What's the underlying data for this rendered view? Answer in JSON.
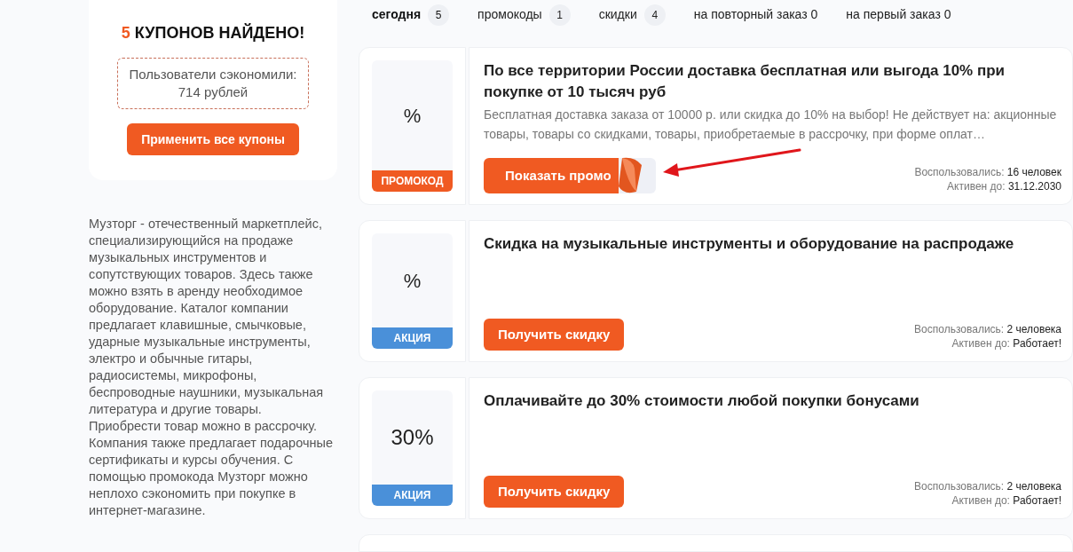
{
  "summary": {
    "count": "5",
    "title": "КУПОНОВ НАЙДЕНО!",
    "savings": "Пользователи сэкономили: 714 рублей",
    "apply_button": "Применить все купоны"
  },
  "description": "Музторг - отечественный маркетплейс, специализирующийся на продаже музыкальных инструментов и сопутствующих товаров. Здесь также можно взять в аренду необходимое оборудование. Каталог компании предлагает клавишные, смычковые, ударные музыкальные инструменты, электро и обычные гитары, радиосистемы, микрофоны, беспроводные наушники, музыкальная литература и другие товары. Приобрести товар можно в рассрочку. Компания также предлагает подарочные сертификаты и курсы обучения. С помощью промокода Музторг можно неплохо сэкономить при покупке в интернет-магазине.",
  "tabs": [
    {
      "label": "сегодня",
      "count": "5",
      "selected": true
    },
    {
      "label": "промокоды",
      "count": "1",
      "selected": false
    },
    {
      "label": "скидки",
      "count": "4",
      "selected": false
    },
    {
      "label": "на повторный заказ 0",
      "selected": false
    },
    {
      "label": "на первый заказ 0",
      "selected": false
    }
  ],
  "coupons": [
    {
      "kind": "promo",
      "value": "%",
      "badge": "ПРОМОКОД",
      "title": "По все территории России доставка бесплатная или выгода 10% при покупке от 10 тысяч руб",
      "text": "Бесплатная доставка заказа от 10000 р. или скидка до 10% на выбор! Не действует на: акционные товары, товары со скидками, товары, приобретаемые в рассрочку, при форме оплат…",
      "button": "Показать промо",
      "used_label": "Воспользовались:",
      "used": "16 человек",
      "active_label": "Активен до:",
      "active": "31.12.2030"
    },
    {
      "kind": "sale",
      "value": "%",
      "badge": "АКЦИЯ",
      "title": "Скидка на музыкальные инструменты и оборудование на распродаже",
      "button": "Получить скидку",
      "used_label": "Воспользовались:",
      "used": "2 человека",
      "active_label": "Активен до:",
      "active": "Работает!"
    },
    {
      "kind": "sale",
      "value": "30%",
      "badge": "АКЦИЯ",
      "title": "Оплачивайте до 30% стоимости любой покупки бонусами",
      "button": "Получить скидку",
      "used_label": "Воспользовались:",
      "used": "2 человека",
      "active_label": "Активен до:",
      "active": "Работает!"
    }
  ]
}
